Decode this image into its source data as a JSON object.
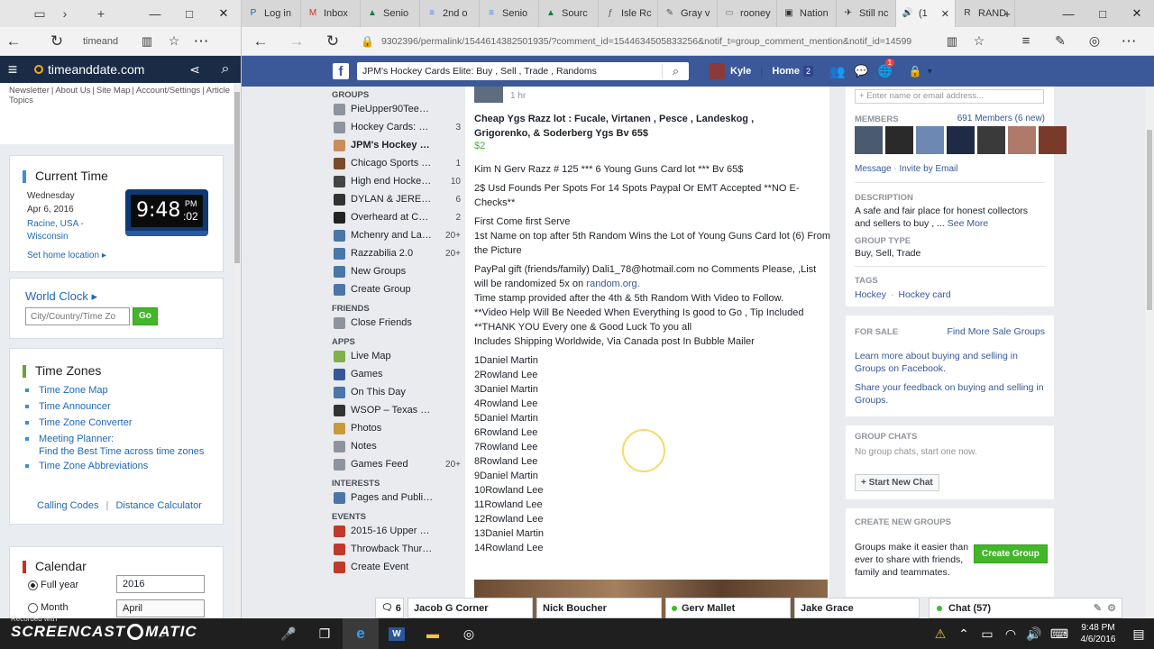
{
  "left_window": {
    "address": "timeand",
    "links": [
      "Newsletter",
      "About Us",
      "Site Map",
      "Account/Settings",
      "Article",
      "Topics"
    ],
    "site_name": "timeanddate.com",
    "current_time": {
      "heading": "Current Time",
      "weekday": "Wednesday",
      "date": "Apr 6, 2016",
      "location": "Racine, USA - Wisconsin",
      "set_home": "Set home location",
      "clock_time": "9:48",
      "clock_ampm": "PM",
      "clock_seconds": ":02"
    },
    "world_clock": {
      "heading": "World Clock",
      "placeholder": "City/Country/Time Zo",
      "go_label": "Go"
    },
    "time_zones": {
      "heading": "Time Zones",
      "items": [
        "Time Zone Map",
        "Time Announcer",
        "Time Zone Converter",
        "Meeting Planner:",
        "Time Zone Abbreviations"
      ],
      "planner_sub": "Find the Best Time across time zones",
      "calling_codes": "Calling Codes",
      "separator": "|",
      "distance_calc": "Distance Calculator"
    },
    "calendar": {
      "heading": "Calendar",
      "full_year_label": "Full year",
      "full_year_value": "2016",
      "month_label": "Month",
      "month_value": "April"
    }
  },
  "tabs": [
    {
      "label": "Log in",
      "icon": "P",
      "color": "#1c5fb8"
    },
    {
      "label": "Inbox",
      "icon": "M",
      "color": "#d93025"
    },
    {
      "label": "Senio",
      "icon": "▲",
      "color": "#188038"
    },
    {
      "label": "2nd o",
      "icon": "≡",
      "color": "#4285f4"
    },
    {
      "label": "Senio",
      "icon": "≡",
      "color": "#4285f4"
    },
    {
      "label": "Sourc",
      "icon": "▲",
      "color": "#188038"
    },
    {
      "label": "Isle Rc",
      "icon": "ƒ",
      "color": "#555555"
    },
    {
      "label": "Gray v",
      "icon": "✎",
      "color": "#555555"
    },
    {
      "label": "rooney",
      "icon": "▭",
      "color": "#777777"
    },
    {
      "label": "Nation",
      "icon": "▣",
      "color": "#333333"
    },
    {
      "label": "Still nc",
      "icon": "✈",
      "color": "#333333"
    },
    {
      "label": "(1",
      "icon": "🔊",
      "color": "#333333"
    },
    {
      "label": "RAND",
      "icon": "R",
      "color": "#333333"
    }
  ],
  "browser": {
    "url": "9302396/permalink/1544614382501935/?comment_id=1544634505833256&notif_t=group_comment_mention&notif_id=14599"
  },
  "facebook": {
    "search_value": "JPM's Hockey Cards Elite: Buy , Sell , Trade , Randoms",
    "user_name": "Kyle",
    "home_label": "Home",
    "home_count": "2",
    "notif_count": "1",
    "sections": [
      {
        "title": "GROUPS",
        "items": [
          {
            "label": "PieUpper90TeeTri...",
            "count": "",
            "icon_color": "#8d949e"
          },
          {
            "label": "Hockey Cards: Buy,...",
            "count": "3",
            "icon_color": "#8d949e"
          },
          {
            "label": "JPM's Hockey Car...",
            "count": "",
            "icon_color": "#c98c5a",
            "bold": true
          },
          {
            "label": "Chicago Sports Me...",
            "count": "1",
            "icon_color": "#7a4a2a"
          },
          {
            "label": "High end Hockey B...",
            "count": "10",
            "icon_color": "#444444"
          },
          {
            "label": "DYLAN & JEREMY'...",
            "count": "6",
            "icon_color": "#333333"
          },
          {
            "label": "Overheard at Carth...",
            "count": "2",
            "icon_color": "#222222"
          },
          {
            "label": "Mchenry and Lake...",
            "count": "20+",
            "icon_color": "#4a76a8"
          },
          {
            "label": "Razzabilia 2.0",
            "count": "20+",
            "icon_color": "#4a76a8"
          },
          {
            "label": "New Groups",
            "count": "",
            "icon_color": "#4a76a8"
          },
          {
            "label": "Create Group",
            "count": "",
            "icon_color": "#4a76a8"
          }
        ]
      },
      {
        "title": "FRIENDS",
        "items": [
          {
            "label": "Close Friends",
            "count": "",
            "icon_color": "#8d949e"
          }
        ]
      },
      {
        "title": "APPS",
        "items": [
          {
            "label": "Live Map",
            "count": "",
            "icon_color": "#7fb24a"
          },
          {
            "label": "Games",
            "count": "",
            "icon_color": "#365899"
          },
          {
            "label": "On This Day",
            "count": "",
            "icon_color": "#4a76a8"
          },
          {
            "label": "WSOP – Texas Hol...",
            "count": "",
            "icon_color": "#333333"
          },
          {
            "label": "Photos",
            "count": "",
            "icon_color": "#c99a3b"
          },
          {
            "label": "Notes",
            "count": "",
            "icon_color": "#8d949e"
          },
          {
            "label": "Games Feed",
            "count": "20+",
            "icon_color": "#8d949e"
          }
        ]
      },
      {
        "title": "INTERESTS",
        "items": [
          {
            "label": "Pages and Public...",
            "count": "",
            "icon_color": "#4a76a8"
          }
        ]
      },
      {
        "title": "EVENTS",
        "items": [
          {
            "label": "2015-16 Upper De...",
            "count": "",
            "icon_color": "#c0392b"
          },
          {
            "label": "Throwback Thursd...",
            "count": "",
            "icon_color": "#c0392b"
          },
          {
            "label": "Create Event",
            "count": "",
            "icon_color": "#c0392b"
          }
        ]
      }
    ],
    "post": {
      "time": "1 hr",
      "title": "Cheap Ygs Razz lot : Fucale, Virtanen , Pesce , Landeskog , Grigorenko, & Soderberg Ygs Bv 65$",
      "price": "$2",
      "lines": [
        "Kim N Gerv Razz # 125 *** 6 Young Guns Card lot *** Bv 65$",
        "2$ Usd Founds Per Spots For 14 Spots Paypal Or EMT Accepted **NO E-Checks**",
        "First Come first Serve",
        "1st Name on top after 5th Random Wins the Lot of Young Guns Card lot (6) From",
        "the Picture",
        "PayPal gift (friends/family) Dali1_78@hotmail.com no Comments Please, ,List will be randomized 5x on",
        "random.org.",
        "Time stamp provided after the 4th & 5th Random With Video to Follow.",
        "**Video Help Will Be Needed When Everything Is good to Go , Tip Included",
        "**THANK YOU Every one & Good Luck To you all",
        "Includes Shipping Worldwide, Via Canada post In Bubble Mailer"
      ],
      "names": [
        "1Daniel Martin",
        "2Rowland Lee",
        "3Daniel Martin",
        "4Rowland Lee",
        "5Daniel Martin",
        "6Rowland Lee",
        "7Rowland Lee",
        "8Rowland Lee",
        "9Daniel Martin",
        "10Rowland Lee",
        "11Rowland Lee",
        "12Rowland Lee",
        "13Daniel Martin",
        "14Rowland Lee"
      ]
    },
    "right": {
      "add_placeholder": "+ Enter name or email address...",
      "members_title": "MEMBERS",
      "members_count": "691 Members (6 new)",
      "message": "Message",
      "invite": "Invite by Email",
      "description_title": "DESCRIPTION",
      "description": "A safe and fair place for honest collectors and sellers to buy , ...",
      "see_more": "See More",
      "group_type_title": "GROUP TYPE",
      "group_type": "Buy, Sell, Trade",
      "tags_title": "TAGS",
      "tags": [
        "Hockey",
        "Hockey card"
      ],
      "tag_sep": "·",
      "for_sale_title": "FOR SALE",
      "find_more": "Find More Sale Groups",
      "learn_more": "Learn more about buying and selling in Groups on Facebook.",
      "share_feedback": "Share your feedback on buying and selling in Groups.",
      "group_chats_title": "GROUP CHATS",
      "no_chats": "No group chats, start one now.",
      "start_chat": "+ Start New Chat",
      "create_groups_title": "CREATE NEW GROUPS",
      "create_desc": "Groups make it easier than ever to share with friends, family and teammates.",
      "create_btn": "Create Group"
    },
    "chat_tabs": [
      "Jacob G Corner",
      "Nick Boucher",
      "Gerv Mallet",
      "Jake Grace"
    ],
    "chat_count": "6",
    "chat_label": "Chat (57)"
  },
  "watermark": "SCREENCAST",
  "watermark_b": "MATIC",
  "watermark_small": "Recorded with",
  "taskbar": {
    "time": "9:48 PM",
    "date": "4/6/2016"
  }
}
